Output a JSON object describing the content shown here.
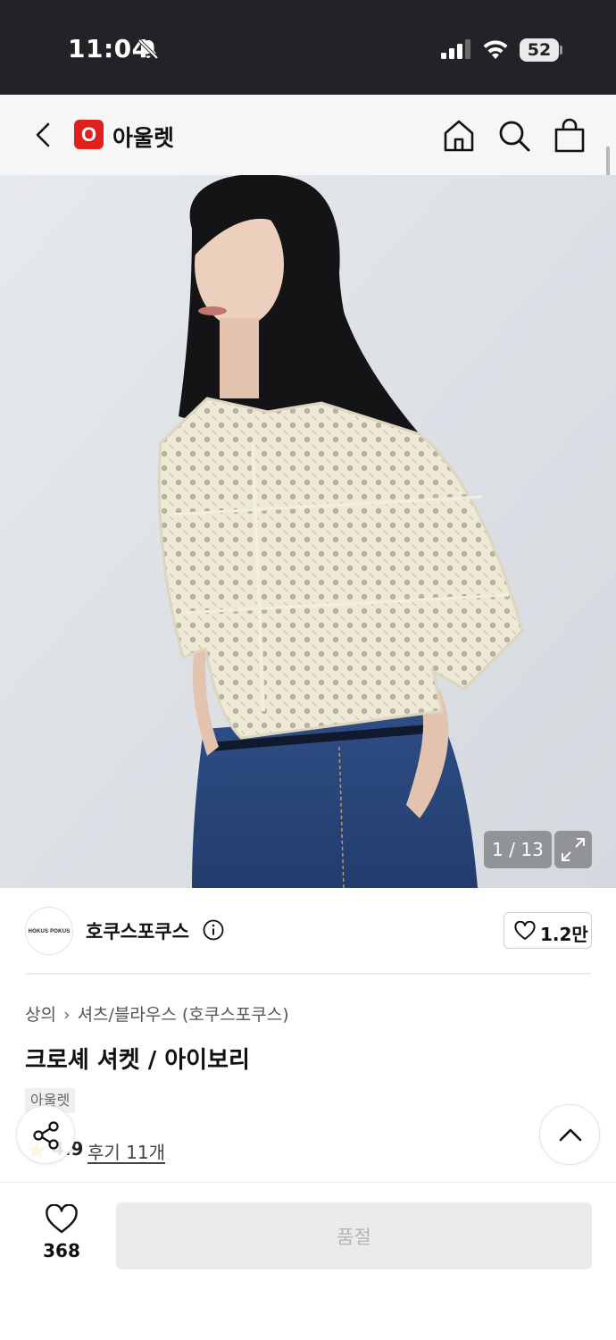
{
  "status_bar": {
    "time": "11:04",
    "battery": "52",
    "icons": [
      "bell-muted-icon",
      "signal-icon",
      "wifi-icon",
      "battery-icon"
    ]
  },
  "header": {
    "logo_letter": "O",
    "title": "아울렛",
    "icons": [
      "back-arrow-icon",
      "home-icon",
      "search-icon",
      "shopping-bag-icon"
    ],
    "logo_color": "#e0201c"
  },
  "image": {
    "counter": "1 / 13",
    "alt": "model wearing cream crochet shirt",
    "icons": [
      "expand-icon"
    ]
  },
  "brand": {
    "logo_text": "HOKUS POKUS",
    "name": "호쿠스포쿠스",
    "likes": "1.2만",
    "icons": [
      "info-icon",
      "heart-outline-icon"
    ]
  },
  "product": {
    "breadcrumb": [
      "상의",
      "셔츠/블라우스 (호쿠스포쿠스)"
    ],
    "title": "크로셰 셔켓 / 아이보리",
    "tag": "아울렛",
    "rating": "4.9",
    "review_link": "후기 11개"
  },
  "floating": {
    "icons": [
      "share-icon",
      "chevron-up-icon"
    ]
  },
  "bottom_bar": {
    "wish_count": "368",
    "action_label": "품절",
    "icons": [
      "heart-outline-icon"
    ]
  }
}
